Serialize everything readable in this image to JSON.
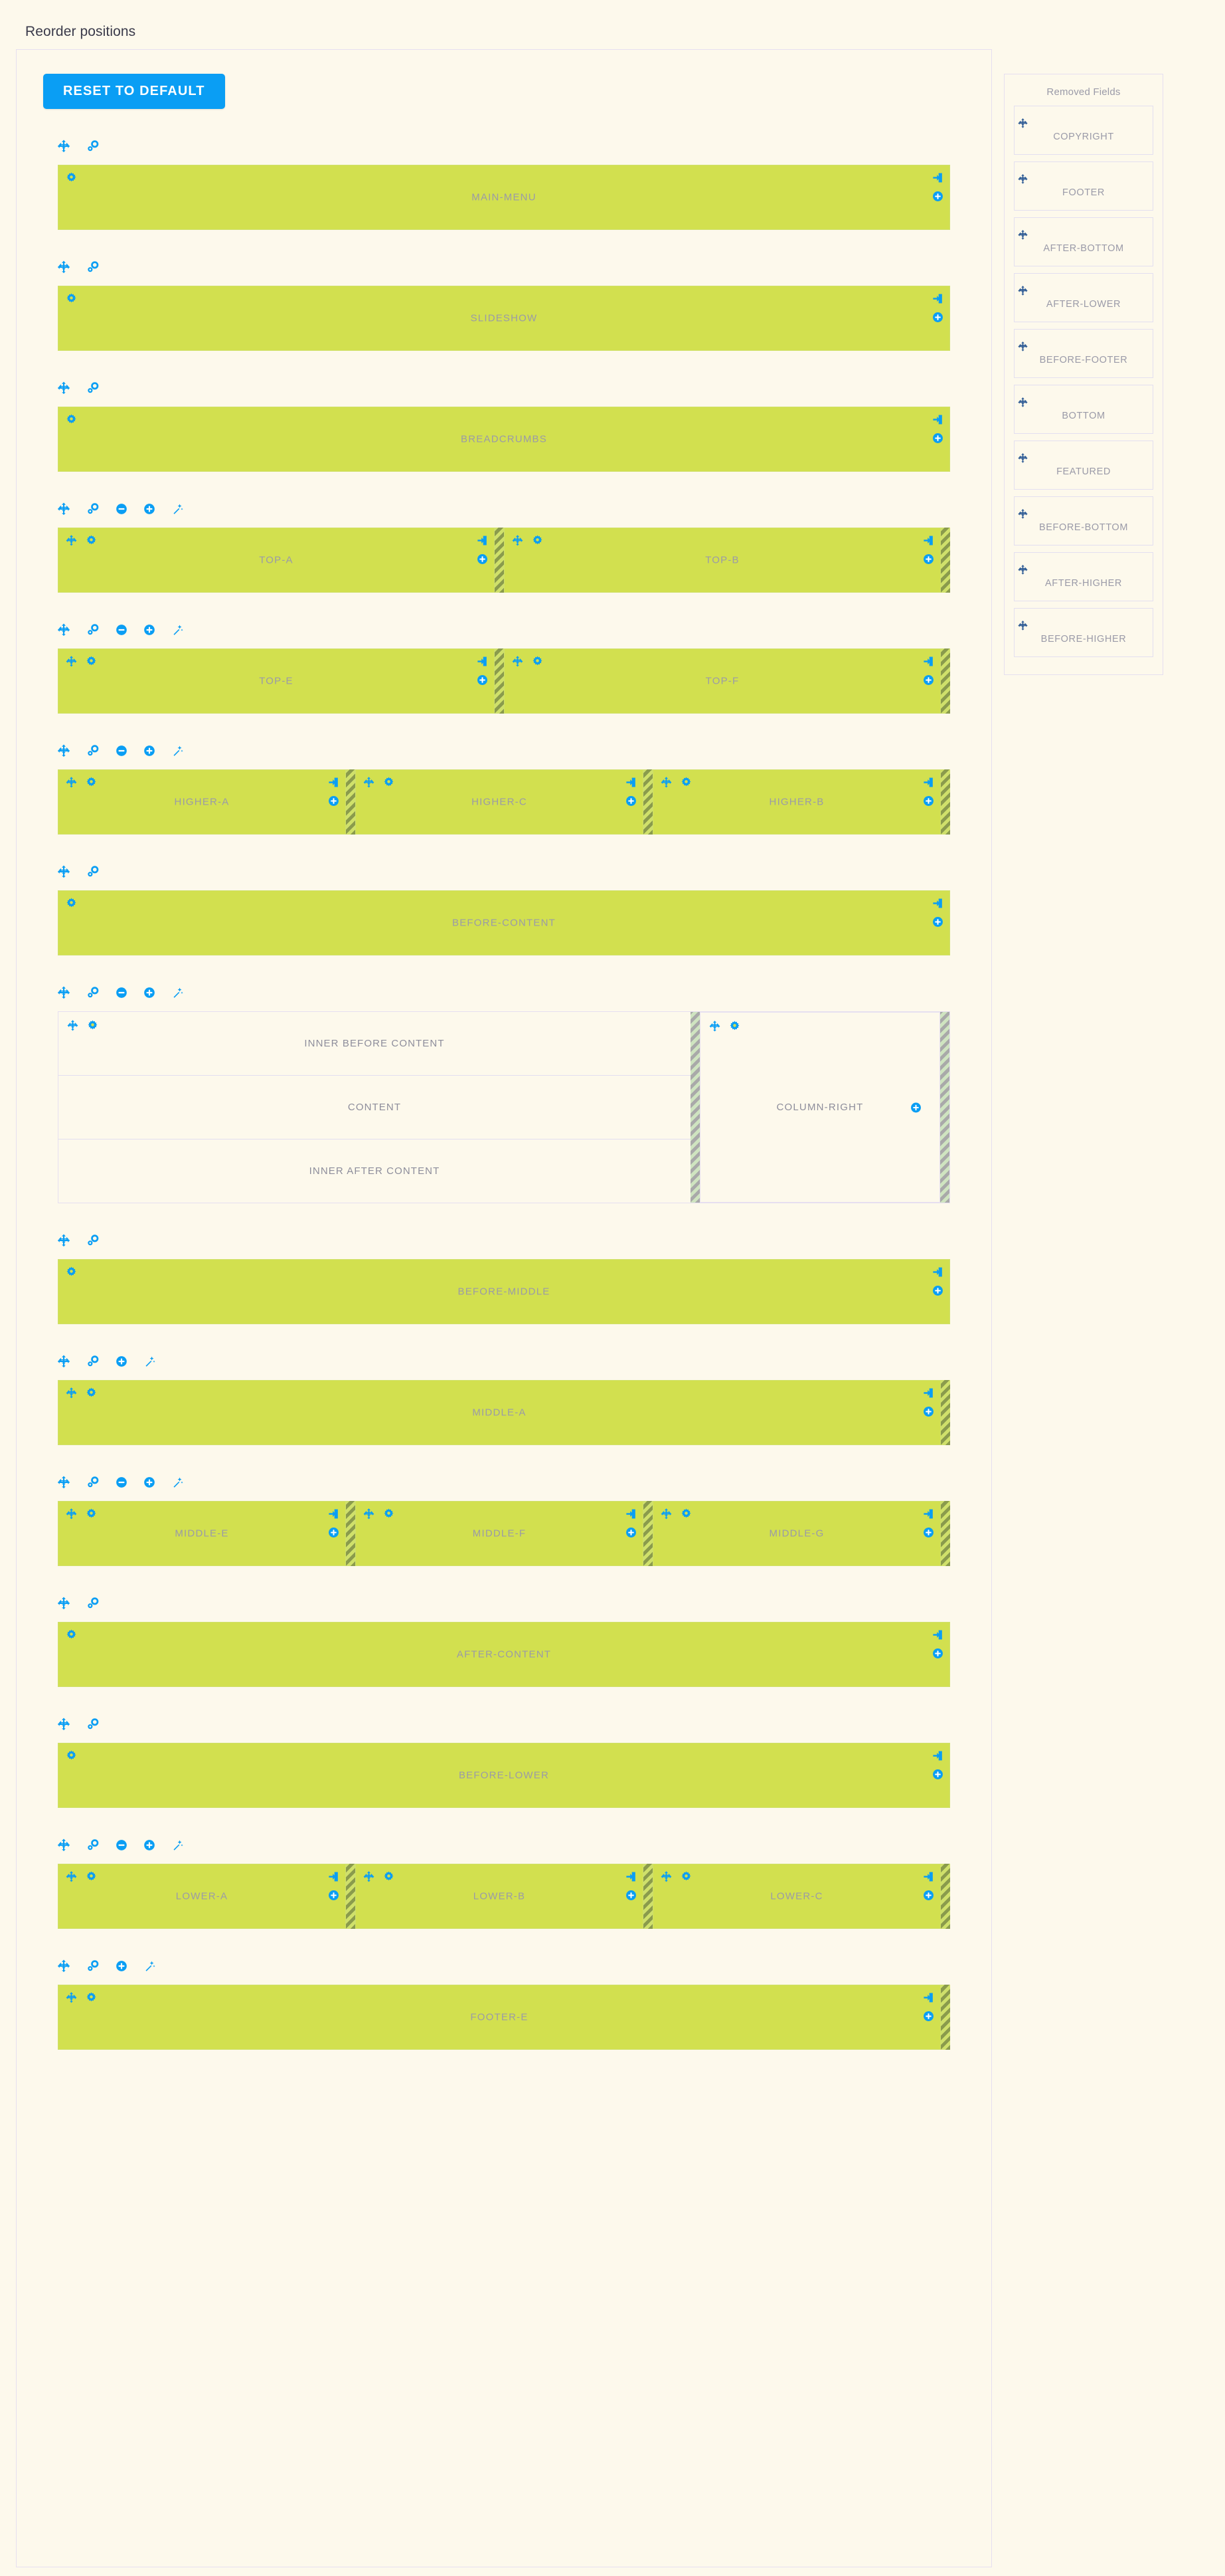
{
  "page": {
    "title": "Reorder positions",
    "reset_button": "RESET TO DEFAULT"
  },
  "colors": {
    "accent_blue": "#0a9ef4",
    "block_green": "#d2e04f",
    "page_bg": "#fdf9ec",
    "label_gray": "#9a9aa8",
    "border_lilac": "#e6dff0",
    "move_icon_dark": "#2d5a94"
  },
  "toolbar_icon_names": {
    "move": "move-arrows-icon",
    "link": "link-settings-icon",
    "minus": "circle-minus-icon",
    "plus": "circle-plus-icon",
    "wand": "magic-wand-icon",
    "gear": "gear-icon",
    "insert": "insert-into-box-icon"
  },
  "rows": [
    {
      "id": "main-menu",
      "toolbar": [
        "move",
        "link"
      ],
      "blocks": [
        {
          "label": "MAIN-MENU",
          "left_icons": [
            "gear"
          ],
          "right_icons": [
            "insert",
            "plus"
          ],
          "handle_after": false
        }
      ]
    },
    {
      "id": "slideshow",
      "toolbar": [
        "move",
        "link"
      ],
      "blocks": [
        {
          "label": "SLIDESHOW",
          "left_icons": [
            "gear"
          ],
          "right_icons": [
            "insert",
            "plus"
          ],
          "handle_after": false
        }
      ]
    },
    {
      "id": "breadcrumbs",
      "toolbar": [
        "move",
        "link"
      ],
      "blocks": [
        {
          "label": "BREADCRUMBS",
          "left_icons": [
            "gear"
          ],
          "right_icons": [
            "insert",
            "plus"
          ],
          "handle_after": false
        }
      ]
    },
    {
      "id": "top-a-b",
      "toolbar": [
        "move",
        "link",
        "minus",
        "plus",
        "wand"
      ],
      "blocks": [
        {
          "label": "TOP-A",
          "left_icons": [
            "move",
            "gear"
          ],
          "right_icons": [
            "insert",
            "plus"
          ],
          "handle_after": true
        },
        {
          "label": "TOP-B",
          "left_icons": [
            "move",
            "gear"
          ],
          "right_icons": [
            "insert",
            "plus"
          ],
          "handle_after": true
        }
      ]
    },
    {
      "id": "top-e-f",
      "toolbar": [
        "move",
        "link",
        "minus",
        "plus",
        "wand"
      ],
      "blocks": [
        {
          "label": "TOP-E",
          "left_icons": [
            "move",
            "gear"
          ],
          "right_icons": [
            "insert",
            "plus"
          ],
          "handle_after": true
        },
        {
          "label": "TOP-F",
          "left_icons": [
            "move",
            "gear"
          ],
          "right_icons": [
            "insert",
            "plus"
          ],
          "handle_after": true
        }
      ]
    },
    {
      "id": "higher-a-c-b",
      "toolbar": [
        "move",
        "link",
        "minus",
        "plus",
        "wand"
      ],
      "blocks": [
        {
          "label": "HIGHER-A",
          "left_icons": [
            "move",
            "gear"
          ],
          "right_icons": [
            "insert",
            "plus"
          ],
          "handle_after": true
        },
        {
          "label": "HIGHER-C",
          "left_icons": [
            "move",
            "gear"
          ],
          "right_icons": [
            "insert",
            "plus"
          ],
          "handle_after": true
        },
        {
          "label": "HIGHER-B",
          "left_icons": [
            "move",
            "gear"
          ],
          "right_icons": [
            "insert",
            "plus"
          ],
          "handle_after": true
        }
      ]
    },
    {
      "id": "before-content",
      "toolbar": [
        "move",
        "link"
      ],
      "blocks": [
        {
          "label": "BEFORE-CONTENT",
          "left_icons": [
            "gear"
          ],
          "right_icons": [
            "insert",
            "plus"
          ],
          "handle_after": false
        }
      ]
    },
    {
      "id": "before-middle",
      "toolbar": [
        "move",
        "link"
      ],
      "blocks": [
        {
          "label": "BEFORE-MIDDLE",
          "left_icons": [
            "gear"
          ],
          "right_icons": [
            "insert",
            "plus"
          ],
          "handle_after": false
        }
      ]
    },
    {
      "id": "middle-a",
      "toolbar": [
        "move",
        "link",
        "plus",
        "wand"
      ],
      "blocks": [
        {
          "label": "MIDDLE-A",
          "left_icons": [
            "move",
            "gear"
          ],
          "right_icons": [
            "insert",
            "plus"
          ],
          "handle_after": true
        }
      ]
    },
    {
      "id": "middle-e-f-g",
      "toolbar": [
        "move",
        "link",
        "minus",
        "plus",
        "wand"
      ],
      "blocks": [
        {
          "label": "MIDDLE-E",
          "left_icons": [
            "move",
            "gear"
          ],
          "right_icons": [
            "insert",
            "plus"
          ],
          "handle_after": true
        },
        {
          "label": "MIDDLE-F",
          "left_icons": [
            "move",
            "gear"
          ],
          "right_icons": [
            "insert",
            "plus"
          ],
          "handle_after": true
        },
        {
          "label": "MIDDLE-G",
          "left_icons": [
            "move",
            "gear"
          ],
          "right_icons": [
            "insert",
            "plus"
          ],
          "handle_after": true
        }
      ]
    },
    {
      "id": "after-content",
      "toolbar": [
        "move",
        "link"
      ],
      "blocks": [
        {
          "label": "AFTER-CONTENT",
          "left_icons": [
            "gear"
          ],
          "right_icons": [
            "insert",
            "plus"
          ],
          "handle_after": false
        }
      ]
    },
    {
      "id": "before-lower",
      "toolbar": [
        "move",
        "link"
      ],
      "blocks": [
        {
          "label": "BEFORE-LOWER",
          "left_icons": [
            "gear"
          ],
          "right_icons": [
            "insert",
            "plus"
          ],
          "handle_after": false
        }
      ]
    },
    {
      "id": "lower-a-b-c",
      "toolbar": [
        "move",
        "link",
        "minus",
        "plus",
        "wand"
      ],
      "blocks": [
        {
          "label": "LOWER-A",
          "left_icons": [
            "move",
            "gear"
          ],
          "right_icons": [
            "insert",
            "plus"
          ],
          "handle_after": true
        },
        {
          "label": "LOWER-B",
          "left_icons": [
            "move",
            "gear"
          ],
          "right_icons": [
            "insert",
            "plus"
          ],
          "handle_after": true
        },
        {
          "label": "LOWER-C",
          "left_icons": [
            "move",
            "gear"
          ],
          "right_icons": [
            "insert",
            "plus"
          ],
          "handle_after": true
        }
      ]
    },
    {
      "id": "footer-e",
      "toolbar": [
        "move",
        "link",
        "plus",
        "wand"
      ],
      "blocks": [
        {
          "label": "FOOTER-E",
          "left_icons": [
            "move",
            "gear"
          ],
          "right_icons": [
            "insert",
            "plus"
          ],
          "handle_after": true
        }
      ]
    }
  ],
  "content_row": {
    "toolbar": [
      "move",
      "link",
      "minus",
      "plus",
      "wand"
    ],
    "left_column": {
      "left_icons": [
        "move",
        "gear"
      ],
      "segments": [
        "INNER BEFORE CONTENT",
        "CONTENT",
        "INNER AFTER CONTENT"
      ]
    },
    "right_column": {
      "label": "COLUMN-RIGHT",
      "left_icons": [
        "move",
        "gear"
      ],
      "right_icons": [
        "plus"
      ]
    }
  },
  "removed_fields": {
    "title": "Removed Fields",
    "items": [
      {
        "label": "COPYRIGHT"
      },
      {
        "label": "FOOTER"
      },
      {
        "label": "AFTER-BOTTOM"
      },
      {
        "label": "AFTER-LOWER"
      },
      {
        "label": "BEFORE-FOOTER"
      },
      {
        "label": "BOTTOM"
      },
      {
        "label": "FEATURED"
      },
      {
        "label": "BEFORE-BOTTOM"
      },
      {
        "label": "AFTER-HIGHER"
      },
      {
        "label": "BEFORE-HIGHER"
      }
    ]
  }
}
